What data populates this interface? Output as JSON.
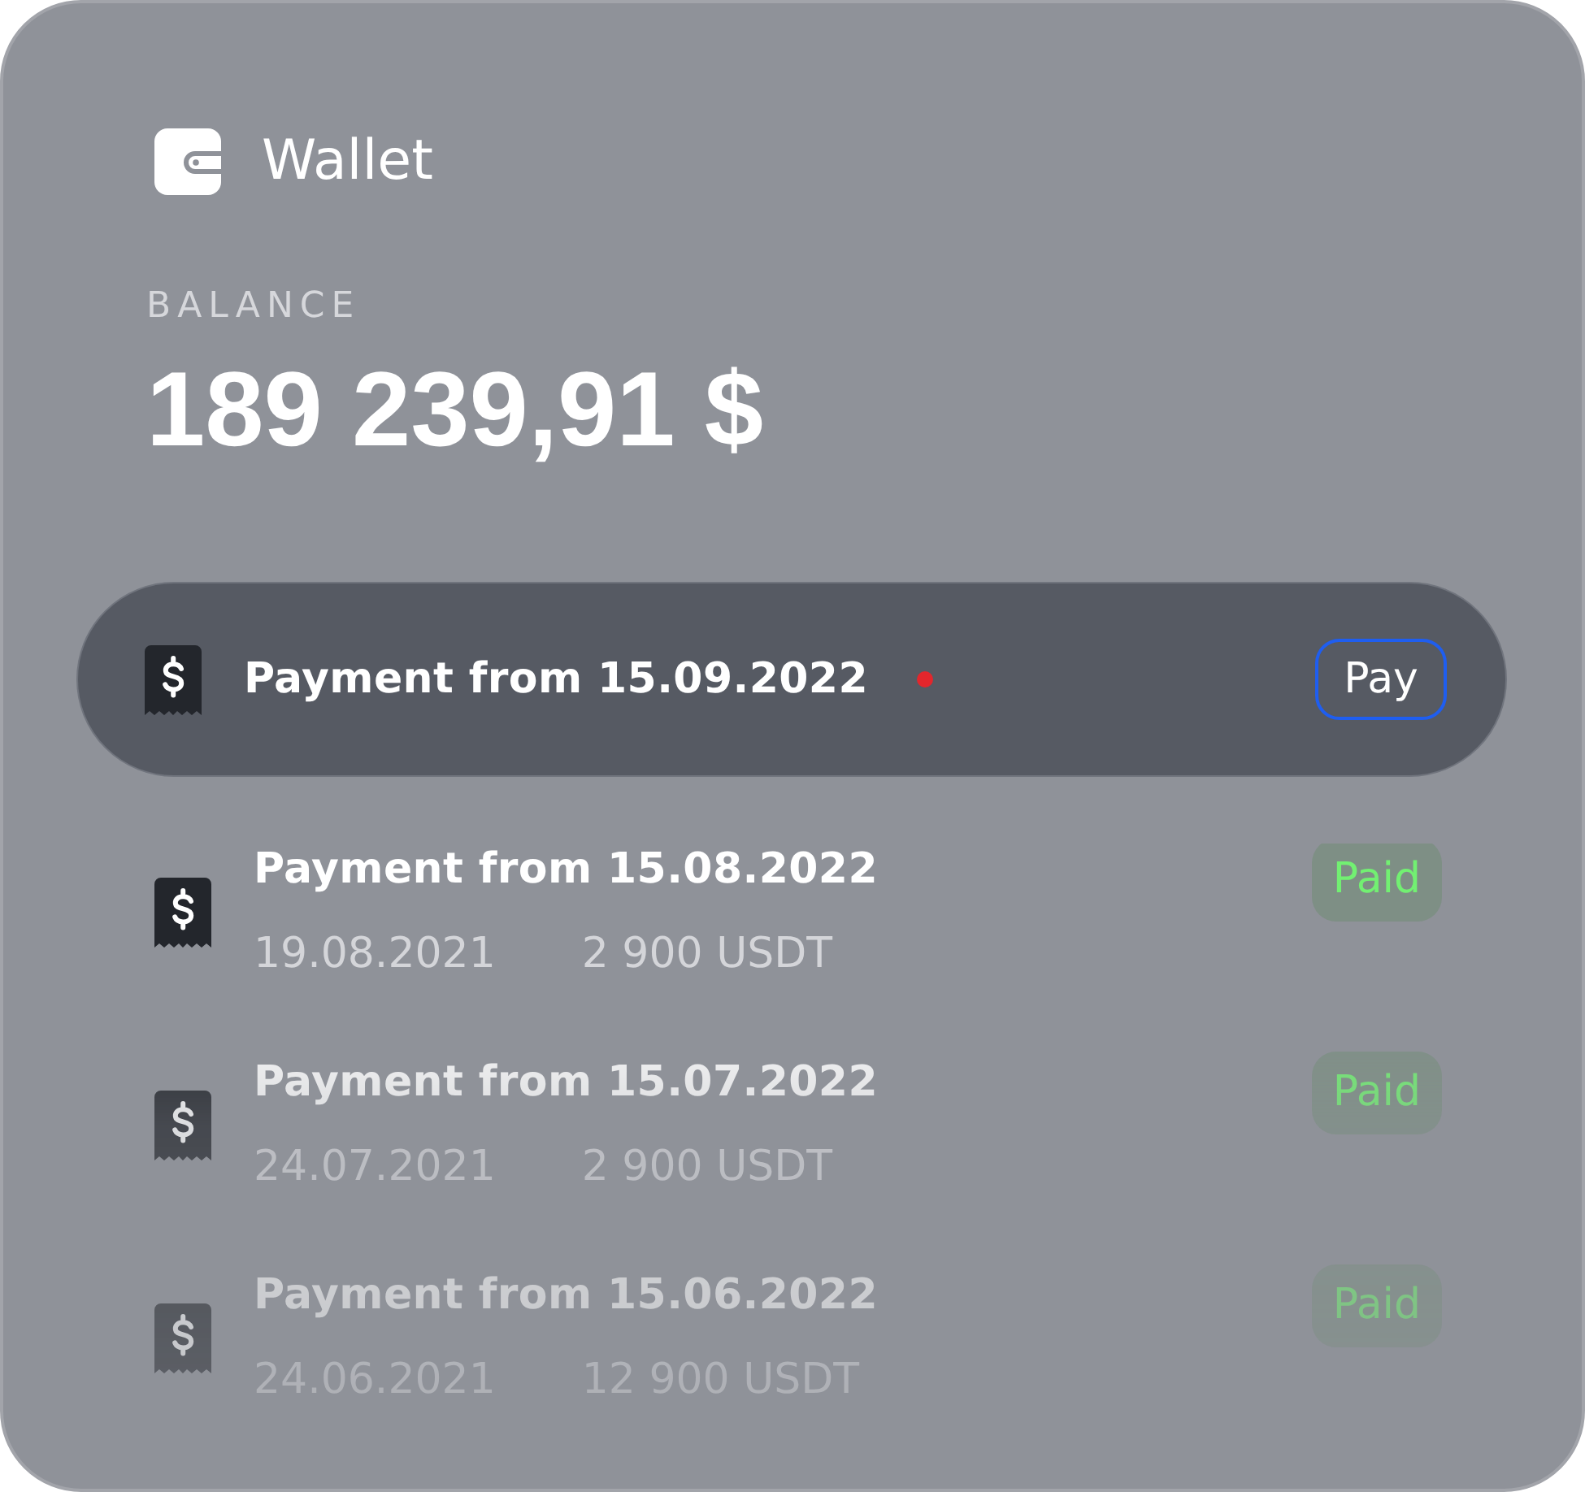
{
  "header": {
    "title": "Wallet"
  },
  "balance": {
    "label": "BALANCE",
    "amount": "189 239,91 $"
  },
  "payments": [
    {
      "kind": "due",
      "title": "Payment from 15.09.2022",
      "unread": true,
      "action": "Pay"
    },
    {
      "kind": "paid",
      "title": "Payment from 15.08.2022",
      "date": "19.08.2021",
      "amount": "2 900 USDT",
      "status": "Paid"
    },
    {
      "kind": "paid",
      "title": "Payment from 15.07.2022",
      "date": "24.07.2021",
      "amount": "2 900 USDT",
      "status": "Paid"
    },
    {
      "kind": "paid",
      "title": "Payment from 15.06.2022",
      "date": "24.06.2021",
      "amount": "12 900 USDT",
      "status": "Paid"
    }
  ]
}
